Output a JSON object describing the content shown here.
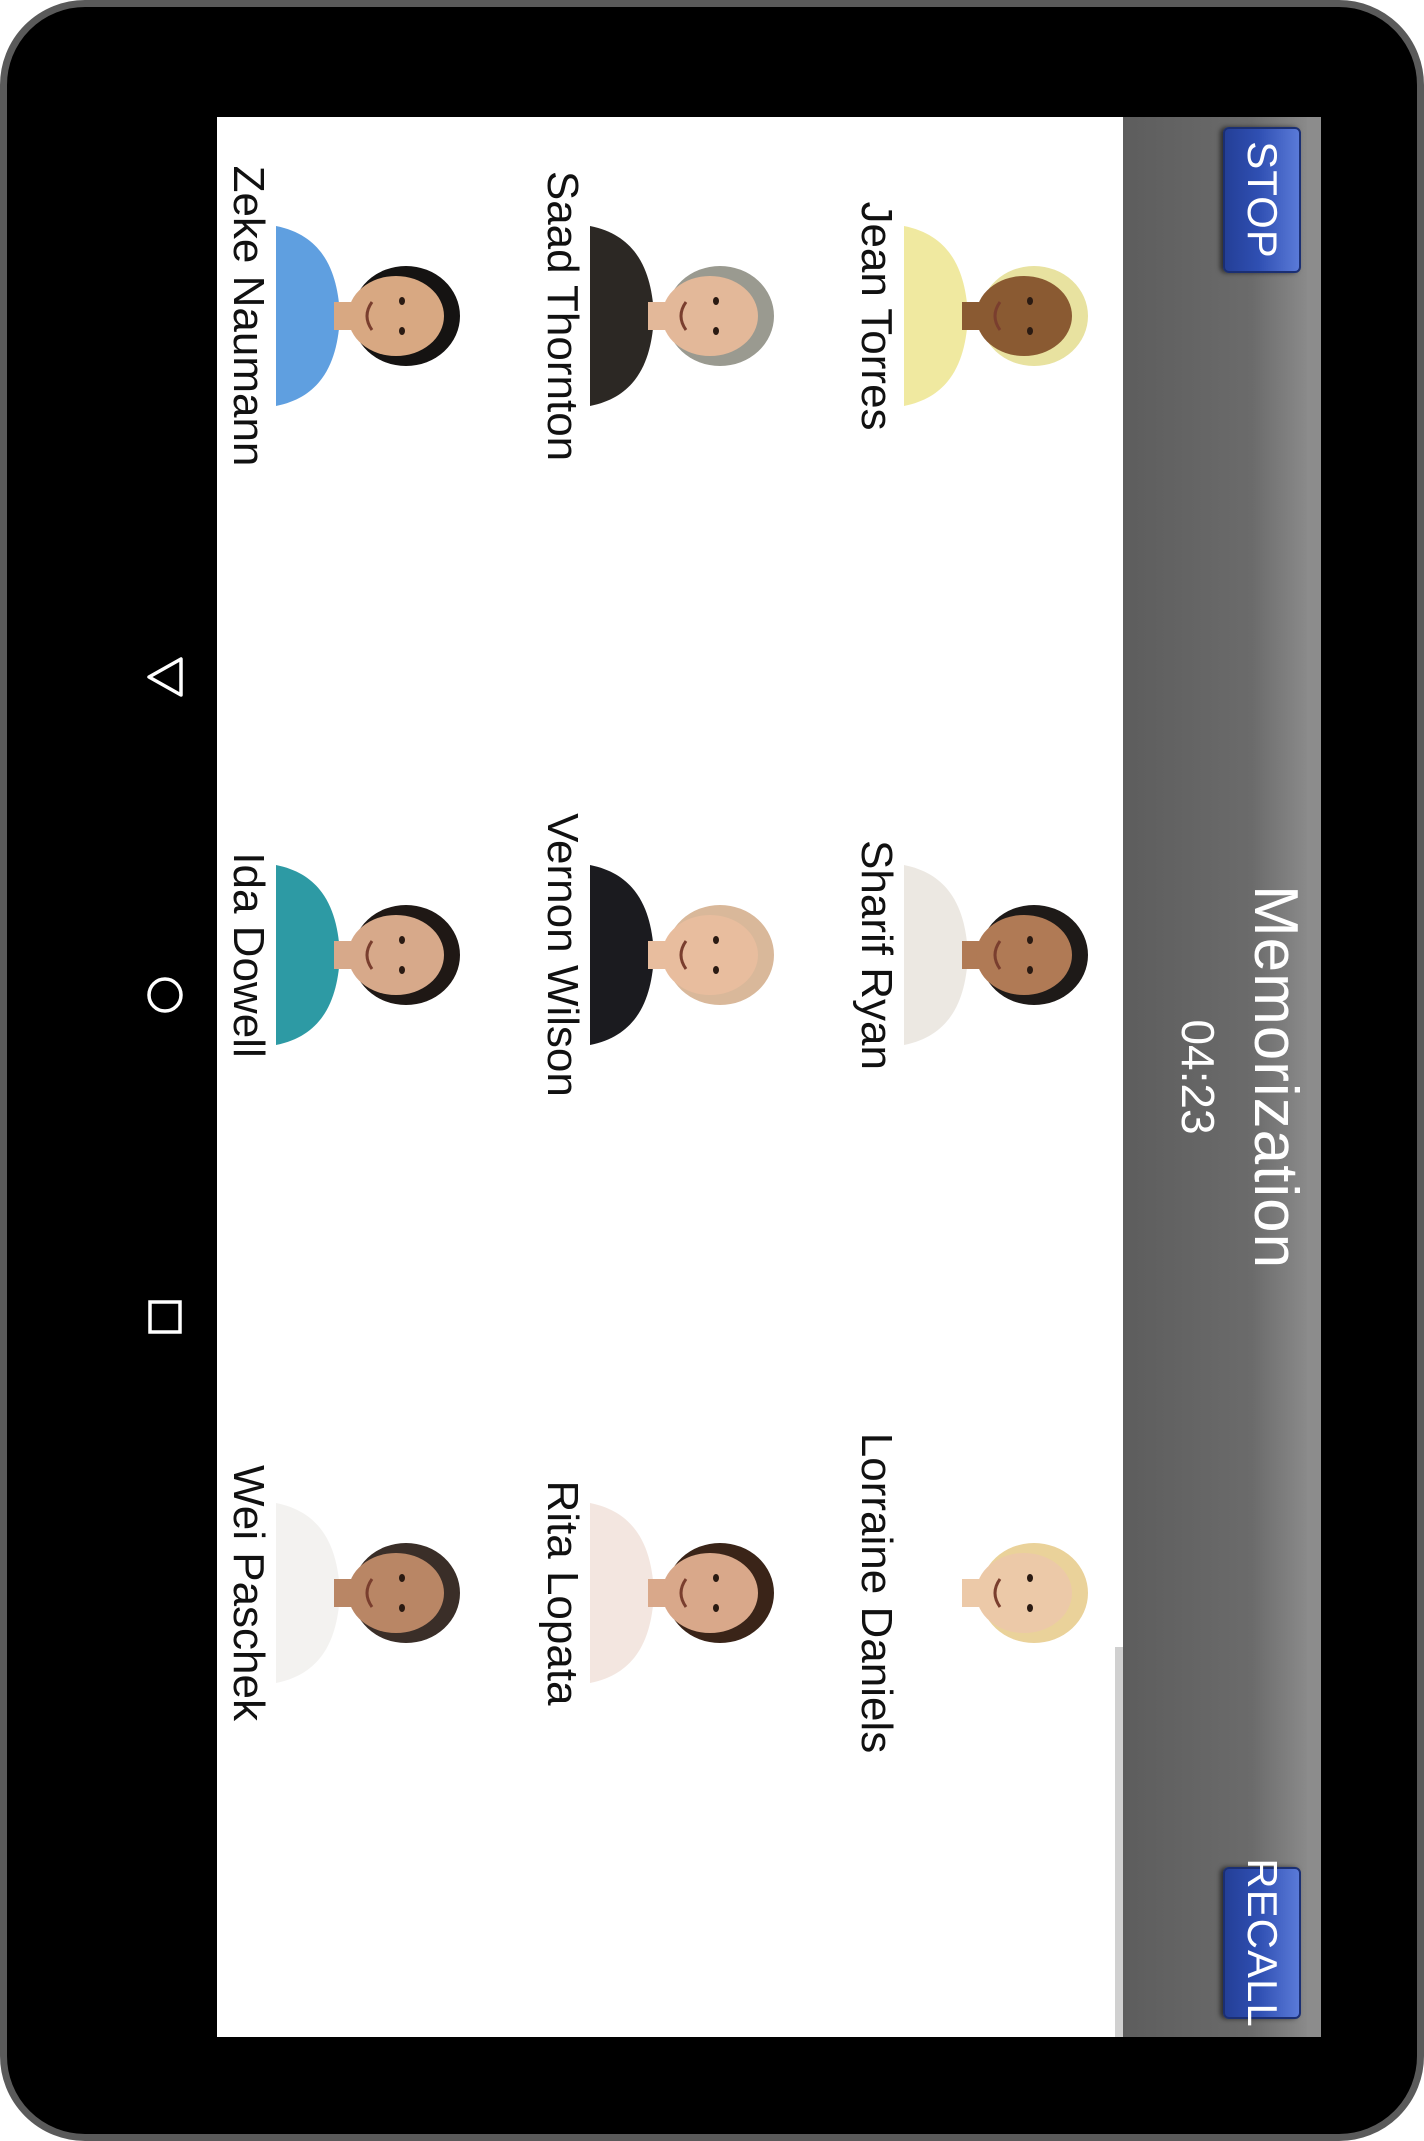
{
  "app": {
    "title": "Memorization",
    "timer": "04:23",
    "stop_label": "STOP",
    "recall_label": "RECALL"
  },
  "people": [
    {
      "name": "Jean Torres",
      "skin": "#8a5a32",
      "hair": "#e8e2a0",
      "shirt": "#f0e9a0",
      "bg": "#ffffff"
    },
    {
      "name": "Sharif Ryan",
      "skin": "#b07a55",
      "hair": "#1e1a18",
      "shirt": "#ece8e2",
      "bg": "#ffffff"
    },
    {
      "name": "Lorraine Daniels",
      "skin": "#ecc9a8",
      "hair": "#ead29a",
      "shirt": "#ffffff",
      "bg": "#ffffff"
    },
    {
      "name": "Saad Thornton",
      "skin": "#e3b899",
      "hair": "#9a9a90",
      "shirt": "#2c2824",
      "bg": "#ffffff"
    },
    {
      "name": "Vernon Wilson",
      "skin": "#e8bd9e",
      "hair": "#d9b89a",
      "shirt": "#1b1b1f",
      "bg": "#ffffff"
    },
    {
      "name": "Rita Lopata",
      "skin": "#d9a88a",
      "hair": "#3a2418",
      "shirt": "#f3e6e0",
      "bg": "#ffffff"
    },
    {
      "name": "Zeke Naumann",
      "skin": "#d8a882",
      "hair": "#151312",
      "shirt": "#5f9fe0",
      "bg": "#ffffff"
    },
    {
      "name": "Ida Dowell",
      "skin": "#d7a98a",
      "hair": "#1f1815",
      "shirt": "#2d9aa4",
      "bg": "#ffffff"
    },
    {
      "name": "Wei Paschek",
      "skin": "#b98665",
      "hair": "#3a2e28",
      "shirt": "#f3f2f0",
      "bg": "#ffffff"
    }
  ],
  "nav": {
    "back_icon": "back-triangle-icon",
    "home_icon": "home-circle-icon",
    "recents_icon": "recents-square-icon"
  }
}
